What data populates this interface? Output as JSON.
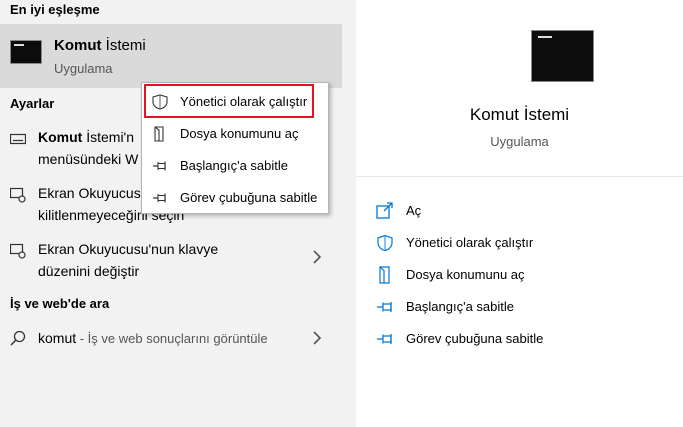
{
  "left": {
    "best_match_heading": "En iyi eşleşme",
    "best_match": {
      "title_bold": "Komut",
      "title_rest": " İstemi",
      "subtitle": "Uygulama"
    },
    "settings_heading": "Ayarlar",
    "settings_items": [
      {
        "line1_bold": "Komut",
        "line1_rest": " İstemi'n",
        "line2": "menüsündeki W"
      },
      {
        "line1": "Ekran Okuyucusu",
        "line2": "kilitlenmeyeceğini seçin"
      },
      {
        "line1": "Ekran Okuyucusu'nun klavye",
        "line2": "düzenini değiştir"
      }
    ],
    "web_heading": "İş ve web'de ara",
    "web_item": {
      "query": "komut",
      "suffix": " - İş ve web sonuçlarını görüntüle"
    }
  },
  "context_menu": {
    "items": [
      {
        "label": "Yönetici olarak çalıştır",
        "icon": "shield-icon"
      },
      {
        "label": "Dosya konumunu aç",
        "icon": "file-location-icon"
      },
      {
        "label": "Başlangıç'a sabitle",
        "icon": "pin-icon"
      },
      {
        "label": "Görev çubuğuna sabitle",
        "icon": "pin-icon"
      }
    ]
  },
  "right": {
    "title": "Komut İstemi",
    "subtitle": "Uygulama",
    "actions": [
      {
        "label": "Aç",
        "icon": "open-icon"
      },
      {
        "label": "Yönetici olarak çalıştır",
        "icon": "shield-icon"
      },
      {
        "label": "Dosya konumunu aç",
        "icon": "file-location-icon"
      },
      {
        "label": "Başlangıç'a sabitle",
        "icon": "pin-icon"
      },
      {
        "label": "Görev çubuğuna sabitle",
        "icon": "pin-icon"
      }
    ]
  },
  "colors": {
    "accent": "#0078d7",
    "highlight_border": "#e81123",
    "pane_bg": "#f2f2f2",
    "selected_bg": "#dadada"
  }
}
